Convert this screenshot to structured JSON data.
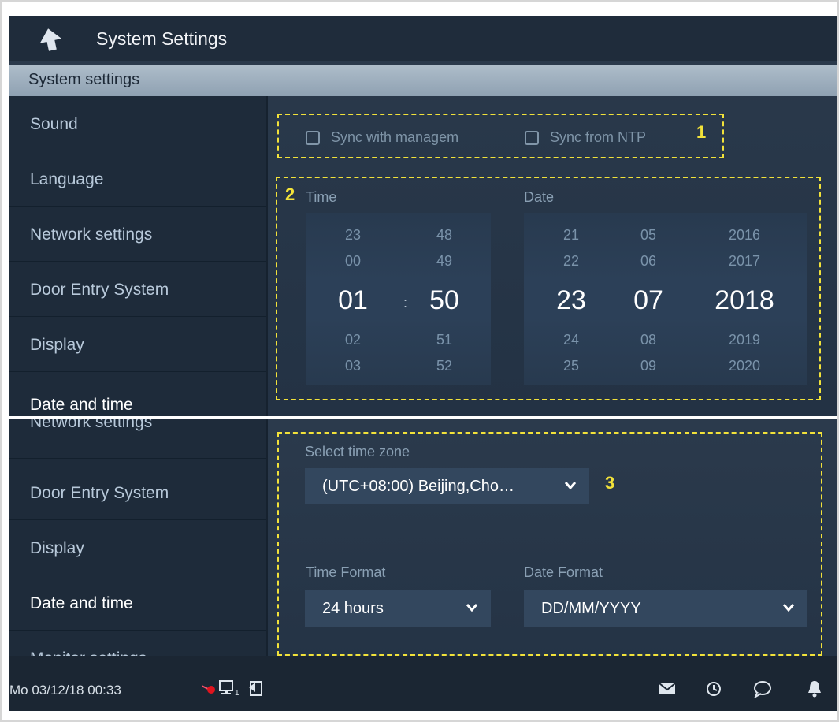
{
  "header": {
    "title": "System Settings"
  },
  "subheader": {
    "title": "System settings"
  },
  "sidebar_top": [
    "Sound",
    "Language",
    "Network settings",
    "Door Entry System",
    "Display",
    "Date and time"
  ],
  "sidebar_bottom": [
    "Network settings",
    "Door Entry System",
    "Display",
    "Date and time",
    "Monitor settings"
  ],
  "sync": {
    "management_label": "Sync with managem",
    "ntp_label": "Sync from NTP"
  },
  "callouts": {
    "one": "1",
    "two": "2",
    "three": "3"
  },
  "time": {
    "label": "Time",
    "hours": [
      "23",
      "00",
      "01",
      "02",
      "03"
    ],
    "minutes": [
      "48",
      "49",
      "50",
      "51",
      "52"
    ],
    "separator": ":"
  },
  "date": {
    "label": "Date",
    "days": [
      "21",
      "22",
      "23",
      "24",
      "25"
    ],
    "months": [
      "05",
      "06",
      "07",
      "08",
      "09"
    ],
    "years": [
      "2016",
      "2017",
      "2018",
      "2019",
      "2020"
    ]
  },
  "timezone": {
    "label": "Select time zone",
    "value": "(UTC+08:00) Beijing,Cho…"
  },
  "time_format": {
    "label": "Time Format",
    "value": "24 hours"
  },
  "date_format": {
    "label": "Date Format",
    "value": "DD/MM/YYYY"
  },
  "footer": {
    "datetime": "Mo 03/12/18   00:33",
    "monitor_sub": "1"
  },
  "colors": {
    "accent_dash": "#f2e23a",
    "header_bg": "#1f2c3b",
    "panel_bg": "#2b3a4c"
  }
}
